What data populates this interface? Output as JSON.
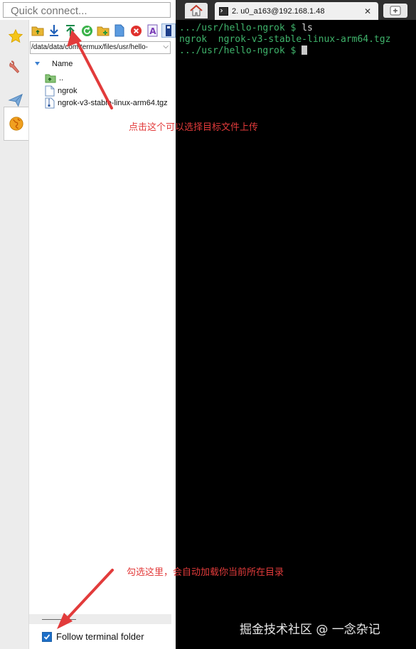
{
  "quick_connect": {
    "placeholder": "Quick connect..."
  },
  "sidebar_tabs": [
    {
      "icon": "star-icon"
    },
    {
      "icon": "tools-icon"
    },
    {
      "icon": "paper-plane-icon"
    },
    {
      "icon": "globe-icon",
      "active": true
    }
  ],
  "sftp": {
    "toolbar": [
      "upload-folder-icon",
      "download-icon",
      "upload-icon",
      "refresh-icon",
      "new-folder-icon",
      "new-file-icon",
      "delete-icon",
      "rename-icon",
      "terminal-icon"
    ],
    "path": "/data/data/com.termux/files/usr/hello-",
    "column_name": "Name",
    "files": [
      {
        "name": "..",
        "icon": "parent-folder-icon"
      },
      {
        "name": "ngrok",
        "icon": "file-icon"
      },
      {
        "name": "ngrok-v3-stable-linux-arm64.tgz",
        "icon": "archive-icon"
      }
    ],
    "follow_label": "Follow terminal folder",
    "follow_checked": true
  },
  "terminal": {
    "tab_title": "2. u0_a163@192.168.1.48",
    "lines": [
      {
        "prompt": ".../usr/hello-ngrok $ ",
        "text": "ls"
      },
      {
        "prompt": "",
        "text": "ngrok  ngrok-v3-stable-linux-arm64.tgz"
      },
      {
        "prompt": ".../usr/hello-ngrok $ ",
        "text": ""
      }
    ]
  },
  "annotations": {
    "upload_hint": "点击这个可以选择目标文件上传",
    "follow_hint": "勾选这里，会自动加载你当前所在目录",
    "color": "#e23b3b"
  },
  "watermark": "掘金技术社区 @ 一念杂记"
}
